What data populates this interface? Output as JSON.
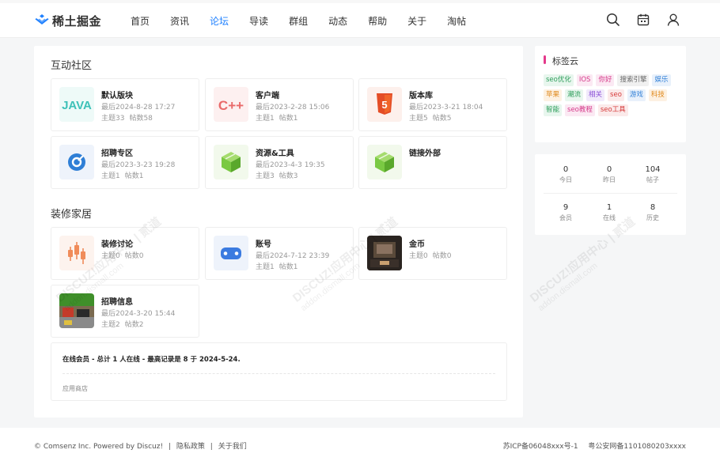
{
  "header": {
    "logo_text": "稀土掘金",
    "nav": [
      {
        "label": "首页",
        "active": false
      },
      {
        "label": "资讯",
        "active": false
      },
      {
        "label": "论坛",
        "active": true
      },
      {
        "label": "导读",
        "active": false
      },
      {
        "label": "群组",
        "active": false
      },
      {
        "label": "动态",
        "active": false
      },
      {
        "label": "帮助",
        "active": false
      },
      {
        "label": "关于",
        "active": false
      },
      {
        "label": "淘帖",
        "active": false
      }
    ],
    "icons": [
      "search-icon",
      "calendar-icon",
      "user-icon"
    ]
  },
  "sections": [
    {
      "title": "互动社区",
      "forums": [
        {
          "name": "默认版块",
          "last": "最后2024-8-28 17:27",
          "topics": "主题33",
          "posts": "帖数58",
          "icon": "java-icon",
          "icon_text": "JAVA",
          "icon_color": "#3ec1b8",
          "icon_bg": "#eefaf8"
        },
        {
          "name": "客户端",
          "last": "最后2023-2-28 15:06",
          "topics": "主题1",
          "posts": "帖数1",
          "icon": "cpp-icon",
          "icon_text": "C++",
          "icon_color": "#e96a6a",
          "icon_bg": "#fdf0f0"
        },
        {
          "name": "版本库",
          "last": "最后2023-3-21 18:04",
          "topics": "主题5",
          "posts": "帖数5",
          "icon": "html5-icon",
          "icon_text": "5",
          "icon_color": "#e44d26",
          "icon_bg": "#fdf0ec"
        },
        {
          "name": "招聘专区",
          "last": "最后2023-3-23 19:28",
          "topics": "主题1",
          "posts": "帖数1",
          "icon": "target-icon",
          "icon_color": "#2f7fd6",
          "icon_bg": "#eef3fb"
        },
        {
          "name": "资源&工具",
          "last": "最后2023-4-3 19:35",
          "topics": "主题3",
          "posts": "帖数3",
          "icon": "cube-icon",
          "icon_color": "#7ac943",
          "icon_bg": "#f2f9ec"
        },
        {
          "name": "链接外部",
          "last": "",
          "topics": "",
          "posts": "",
          "icon": "cube-icon",
          "icon_color": "#7ac943",
          "icon_bg": "#f2f9ec"
        }
      ]
    },
    {
      "title": "装修家居",
      "forums": [
        {
          "name": "装修讨论",
          "last": "",
          "topics": "主题0",
          "posts": "帖数0",
          "icon": "candlestick-icon",
          "icon_color": "#f08c5a",
          "icon_bg": "#fdf3ee"
        },
        {
          "name": "账号",
          "last": "最后2024-7-12 23:39",
          "topics": "主题1",
          "posts": "帖数1",
          "icon": "gamepad-icon",
          "icon_color": "#3b7be0",
          "icon_bg": "#eef3fb"
        },
        {
          "name": "金币",
          "last": "",
          "topics": "主题0",
          "posts": "帖数0",
          "icon": "room-photo-icon",
          "icon_color": "#5a4a3a",
          "icon_bg": "#2a2420"
        },
        {
          "name": "招聘信息",
          "last": "最后2024-3-20 15:44",
          "topics": "主题2",
          "posts": "帖数2",
          "icon": "street-photo-icon",
          "icon_color": "#5aa83a",
          "icon_bg": "#eaf4e4"
        }
      ]
    }
  ],
  "online": {
    "title": "在线会员 - 总计 1 人在线 - 最高记录是 8 于 2024-5-24.",
    "link": "应用商店"
  },
  "tag_cloud": {
    "title": "标签云",
    "accent": "#e4398b",
    "tags": [
      {
        "label": "seo优化",
        "color": "#2e9e5b",
        "bg": "#e8f6ee"
      },
      {
        "label": "IOS",
        "color": "#d63a8a",
        "bg": "#fbe9f3"
      },
      {
        "label": "你好",
        "color": "#d63a8a",
        "bg": "#fbe9f3"
      },
      {
        "label": "搜索引擎",
        "color": "#666666",
        "bg": "#f0f0f0"
      },
      {
        "label": "娱乐",
        "color": "#2f7fd6",
        "bg": "#e9f1fb"
      },
      {
        "label": "苹果",
        "color": "#e08a1e",
        "bg": "#fdf1e2"
      },
      {
        "label": "潮流",
        "color": "#2e9e5b",
        "bg": "#e8f6ee"
      },
      {
        "label": "相关",
        "color": "#8a4fd6",
        "bg": "#f1eafb"
      },
      {
        "label": "seo",
        "color": "#d63a3a",
        "bg": "#fbeaea"
      },
      {
        "label": "游戏",
        "color": "#2f7fd6",
        "bg": "#e9f1fb"
      },
      {
        "label": "科技",
        "color": "#e08a1e",
        "bg": "#fdf1e2"
      },
      {
        "label": "智能",
        "color": "#2e9e5b",
        "bg": "#e8f6ee"
      },
      {
        "label": "seo教程",
        "color": "#d63a8a",
        "bg": "#fbe9f3"
      },
      {
        "label": "seo工具",
        "color": "#d63a3a",
        "bg": "#fbeaea"
      }
    ]
  },
  "stats": [
    {
      "num": "0",
      "label": "今日"
    },
    {
      "num": "0",
      "label": "昨日"
    },
    {
      "num": "104",
      "label": "帖子"
    },
    {
      "num": "9",
      "label": "会员"
    },
    {
      "num": "1",
      "label": "在线"
    },
    {
      "num": "8",
      "label": "历史"
    }
  ],
  "footer": {
    "copyright": "© Comsenz Inc. Powered by Discuz!",
    "privacy": "隐私政策",
    "about": "关于我们",
    "icp": "苏ICP备06048xxx号-1",
    "police": "粤公安网备1101080203xxxx"
  },
  "watermark": {
    "line1": "DISCUZ!应用中心 | 贰道",
    "line2": "addon.dismall.com"
  }
}
